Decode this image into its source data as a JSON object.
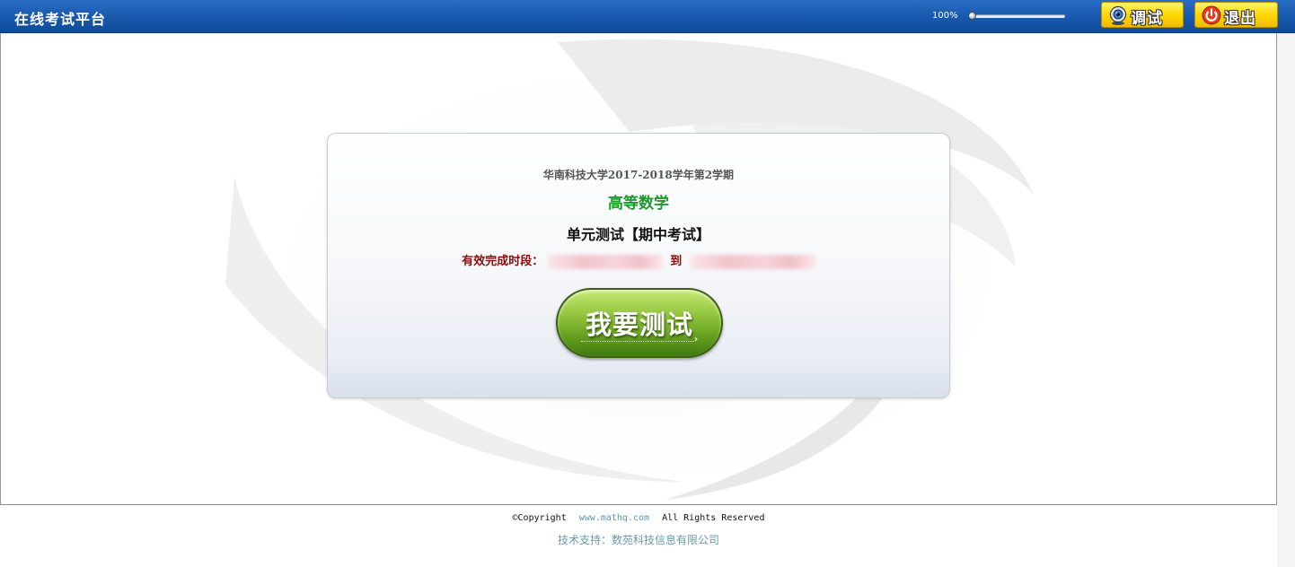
{
  "app": {
    "title": "在线考试平台"
  },
  "toolbar": {
    "zoom_label": "100%",
    "zoom_level": 0.0,
    "debug_label": "调试",
    "exit_label": "退出"
  },
  "exam": {
    "semester": "华南科技大学2017-2018学年第2学期",
    "course": "高等数学",
    "test_name": "单元测试【期中考试】",
    "period_label": "有效完成时段：",
    "period_to": "到",
    "start_button": "我要测试"
  },
  "footer": {
    "copyright_prefix": "©Copyright",
    "site": "www.mathq.com",
    "rights": "All Rights Reserved",
    "support": "技术支持：数苑科技信息有限公司"
  },
  "colors": {
    "topbar": "#1a5bb0",
    "course": "#1b9a2a",
    "period": "#8b0b0b",
    "start_button": "#7ab22e",
    "link": "#5a9aa8"
  }
}
